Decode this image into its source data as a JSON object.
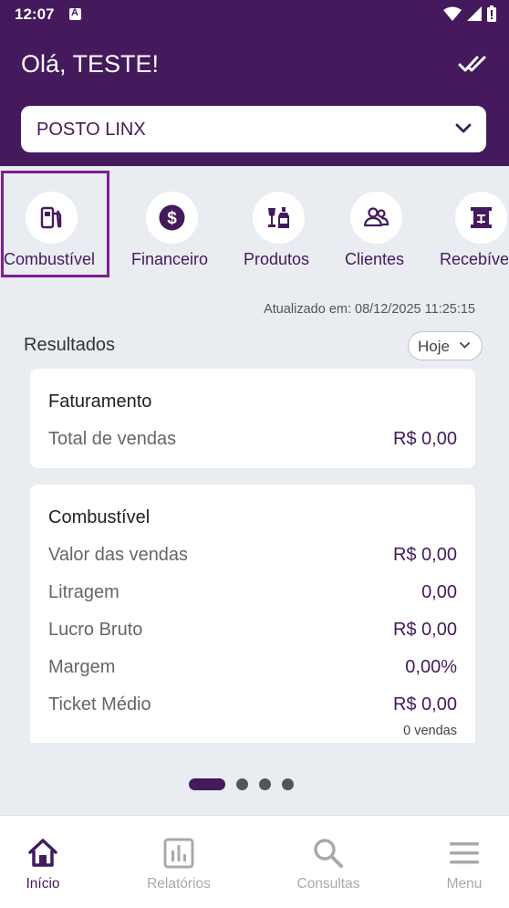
{
  "status_bar": {
    "time": "12:07"
  },
  "header": {
    "greeting": "Olá, TESTE!",
    "station": "POSTO LINX",
    "bg_color": "#441a5c"
  },
  "categories": [
    {
      "label": "Combustível",
      "icon": "fuel-pump-icon",
      "selected": true
    },
    {
      "label": "Financeiro",
      "icon": "dollar-icon"
    },
    {
      "label": "Produtos",
      "icon": "products-icon"
    },
    {
      "label": "Clientes",
      "icon": "clients-icon"
    },
    {
      "label": "Recebíve",
      "icon": "receivables-icon"
    }
  ],
  "updated_text": "Atualizado em: 08/12/2025 11:25:15",
  "results": {
    "title": "Resultados",
    "period": "Hoje"
  },
  "card_faturamento": {
    "title": "Faturamento",
    "rows": [
      {
        "label": "Total de vendas",
        "value": "R$ 0,00"
      }
    ]
  },
  "card_combustivel": {
    "title": "Combustível",
    "rows": [
      {
        "label": "Valor das vendas",
        "value": "R$ 0,00"
      },
      {
        "label": "Litragem",
        "value": "0,00"
      },
      {
        "label": "Lucro Bruto",
        "value": "R$ 0,00"
      },
      {
        "label": "Margem",
        "value": "0,00%"
      },
      {
        "label": "Ticket Médio",
        "value": "R$ 0,00"
      }
    ],
    "sub": "0 vendas"
  },
  "bottom_nav": [
    {
      "label": "Início",
      "icon": "home-icon",
      "active": true
    },
    {
      "label": "Relatórios",
      "icon": "reports-icon"
    },
    {
      "label": "Consultas",
      "icon": "search-icon"
    },
    {
      "label": "Menu",
      "icon": "menu-icon"
    }
  ],
  "colors": {
    "accent": "#441a5c",
    "selected_border": "#7d1f8f",
    "inactive": "#a9a9a9"
  }
}
